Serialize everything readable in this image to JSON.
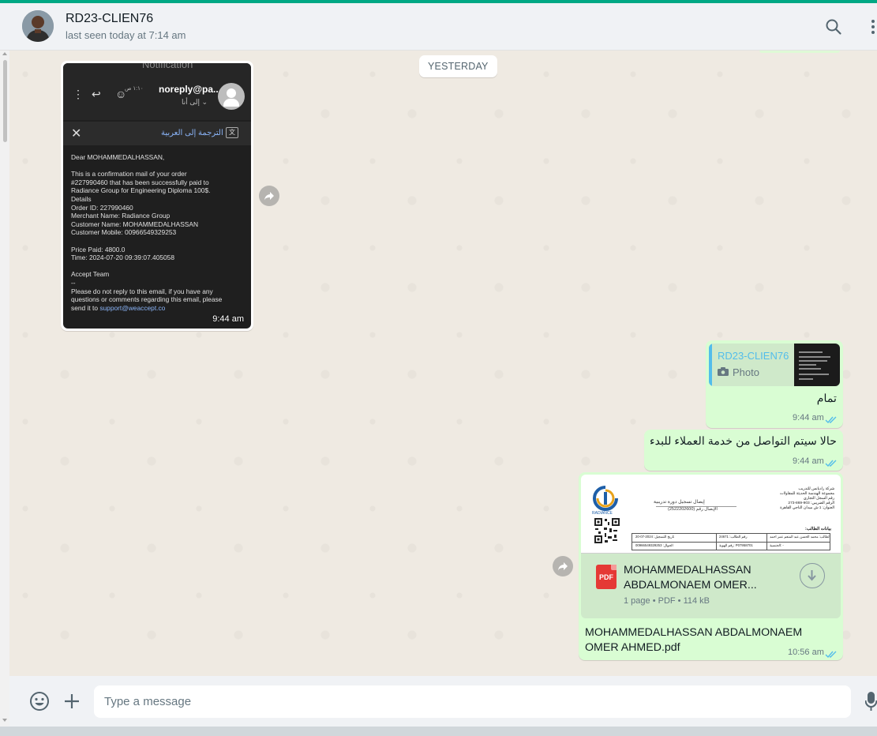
{
  "header": {
    "contact_name": "RD23-CLIEN76",
    "status": "last seen today at 7:14 am",
    "avatar": "person-avatar",
    "icons": [
      "search-icon",
      "more-vertical-icon"
    ]
  },
  "chat": {
    "day_label": "YESTERDAY",
    "incoming_image": {
      "time": "9:44 am",
      "screenshot": {
        "partial_top_text": "Notification",
        "sender": "noreply@pa...",
        "time": "١:١٠ ص",
        "recipient": "إلى أنا ⌄",
        "translate_label": "الترجمة إلى العربية",
        "body_lines": [
          "Dear MOHAMMEDALHASSAN,",
          "",
          "  This is a confirmation mail of your order",
          "#227990460 that has been successfully paid to",
          "Radiance Group for Engineering Diploma 100$.",
          "     Details",
          "     Order ID: 227990460",
          "     Merchant Name: Radiance Group",
          "     Customer Name: MOHAMMEDALHASSAN",
          "     Customer Mobile: 00966549329253",
          "",
          "     Price Paid: 4800.0",
          "     Time: 2024-07-20 09:39:07.405058",
          "",
          "Accept Team",
          "--",
          "Please do not reply to this email, if you have any",
          "questions or comments regarding this email, please"
        ],
        "last_line_prefix": "send it to ",
        "support_link": "support@weaccept.co"
      }
    },
    "reply_message": {
      "quote_name": "RD23-CLIEN76",
      "quote_kind": "Photo",
      "text": "تمام",
      "time": "9:44 am"
    },
    "text_message": {
      "text": "حالا سيتم التواصل من خدمة العملاء للبدء",
      "time": "9:44 am"
    },
    "document_message": {
      "preview": {
        "logo_caption": "RADIANCE",
        "title": "إيصال تسجيل دورة تدريبية",
        "receipt_number": "(2522202600) الإيصال رقم",
        "org_lines": [
          "شركة راديانس للتدريب",
          "مجموعة الهندسة الحديثة للمقاولات",
          "رقم السجل التجاري"
        ],
        "cr_line": "الرقم الضريبي: 903-869-273",
        "address_line": "العنوان: 1 ش ميدان الناجي القاهرة",
        "section_title": "بيانات الطالب:",
        "table_row_1": [
          "20-07-2024 :تاريخ التسجيل",
          "رقم الطالب: 24671",
          "اسم الطالب: محمد الحسن عبد المنعم عمر أحمد"
        ],
        "table_row_2": [
          "00966549329253 :الجوال",
          "رقم الهوية: P07958701",
          "الجنسية: -"
        ]
      },
      "file_name_line1": "MOHAMMEDALHASSAN",
      "file_name_line2": "ABDALMONAEM OMER...",
      "file_meta": "1 page • PDF • 114 kB",
      "file_badge": "PDF",
      "caption": "MOHAMMEDALHASSAN ABDALMONAEM OMER AHMED.pdf",
      "time": "10:56 am"
    }
  },
  "footer": {
    "placeholder": "Type a message",
    "icons": [
      "emoji-icon",
      "attach-plus-icon",
      "microphone-icon"
    ]
  },
  "colors": {
    "accent": "#00a884",
    "outgoing_bubble": "#d9fdd3",
    "read_ticks": "#53bdeb",
    "chat_background": "#efeae2"
  }
}
